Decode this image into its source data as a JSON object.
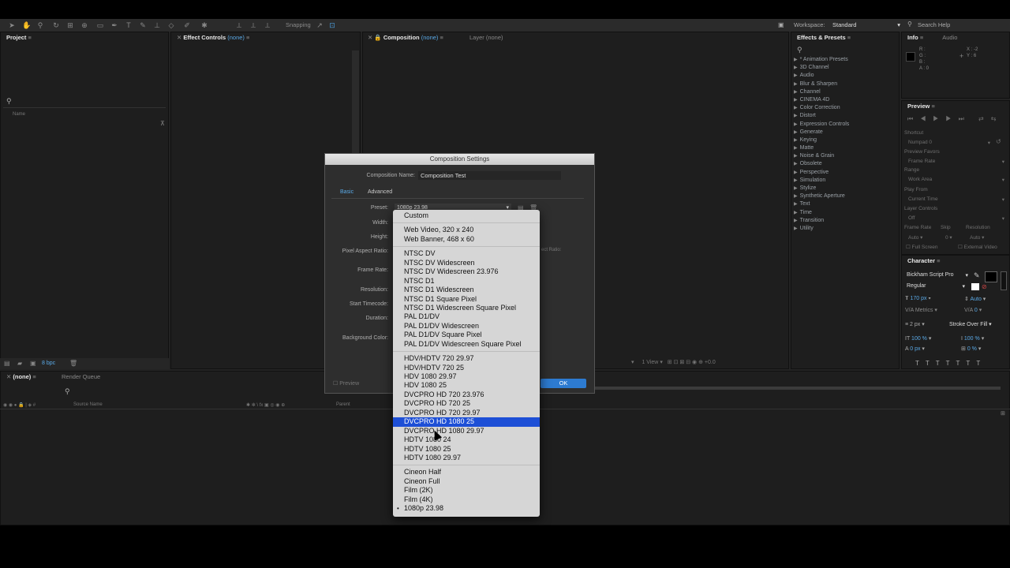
{
  "toolbar": {
    "snapping_label": "Snapping",
    "workspace_label": "Workspace:",
    "workspace_value": "Standard",
    "search_label": "Search Help"
  },
  "project_panel": {
    "title": "Project",
    "name_col": "Name",
    "bpc": "8 bpc"
  },
  "effect_controls": {
    "title": "Effect Controls",
    "target": "(none)"
  },
  "composition": {
    "title": "Composition",
    "target": "(none)",
    "layer_tab": "Layer (none)",
    "view_label": "1 View",
    "exposure": "+0.0"
  },
  "effects_presets": {
    "title": "Effects & Presets",
    "items": [
      "* Animation Presets",
      "3D Channel",
      "Audio",
      "Blur & Sharpen",
      "Channel",
      "CINEMA 4D",
      "Color Correction",
      "Distort",
      "Expression Controls",
      "Generate",
      "Keying",
      "Matte",
      "Noise & Grain",
      "Obsolete",
      "Perspective",
      "Simulation",
      "Stylize",
      "Synthetic Aperture",
      "Text",
      "Time",
      "Transition",
      "Utility"
    ]
  },
  "info": {
    "tab_info": "Info",
    "tab_audio": "Audio",
    "r": "R :",
    "g": "G :",
    "b": "B :",
    "a": "A : 0",
    "x": "X : -2",
    "y": "Y : 6"
  },
  "preview": {
    "title": "Preview",
    "shortcut_label": "Shortcut",
    "shortcut_value": "Numpad 0",
    "favors_label": "Preview Favors",
    "favors_value": "Frame Rate",
    "range_label": "Range",
    "range_value": "Work Area",
    "play_from_label": "Play From",
    "play_from_value": "Current Time",
    "layer_controls_label": "Layer Controls",
    "layer_controls_value": "Off",
    "frame_rate_label": "Frame Rate",
    "skip_label": "Skip",
    "resolution_label": "Resolution",
    "frame_rate_value": "Auto",
    "skip_value": "0",
    "resolution_value": "Auto",
    "full_screen": "Full Screen",
    "external_video": "External Video"
  },
  "character": {
    "title": "Character",
    "font": "Bickham Script Pro",
    "style": "Regular",
    "size": "170 px",
    "leading": "Auto",
    "kerning": "Metrics",
    "tracking": "0",
    "stroke_width": "2 px",
    "stroke_type": "Stroke Over Fill",
    "vscale": "100 %",
    "hscale": "100 %",
    "baseline": "0 px",
    "tsume": "0 %"
  },
  "timeline": {
    "tab": "(none)",
    "render_queue": "Render Queue",
    "source_name": "Source Name",
    "parent": "Parent"
  },
  "dialog": {
    "title": "Composition Settings",
    "comp_name_label": "Composition Name:",
    "comp_name_value": "Composition Test",
    "tab_basic": "Basic",
    "tab_advanced": "Advanced",
    "preset_label": "Preset:",
    "preset_value": "1080p 23.98",
    "width_label": "Width:",
    "height_label": "Height:",
    "par_label": "Pixel Aspect Ratio:",
    "frame_rate_label": "Frame Rate:",
    "resolution_label": "Resolution:",
    "start_tc_label": "Start Timecode:",
    "duration_label": "Duration:",
    "bg_color_label": "Background Color:",
    "aspect_ratio_frag": "ect Ratio:",
    "preview_label": "Preview",
    "ok_label": "OK"
  },
  "preset_menu": {
    "groups": [
      [
        "Custom"
      ],
      [
        "Web Video, 320 x 240",
        "Web Banner, 468 x 60"
      ],
      [
        "NTSC DV",
        "NTSC DV Widescreen",
        "NTSC DV Widescreen 23.976",
        "NTSC D1",
        "NTSC D1 Widescreen",
        "NTSC D1 Square Pixel",
        "NTSC D1 Widescreen Square Pixel",
        "PAL D1/DV",
        "PAL D1/DV Widescreen",
        "PAL D1/DV Square Pixel",
        "PAL D1/DV Widescreen Square Pixel"
      ],
      [
        "HDV/HDTV 720 29.97",
        "HDV/HDTV 720 25",
        "HDV 1080 29.97",
        "HDV 1080 25",
        "DVCPRO HD 720 23.976",
        "DVCPRO HD 720 25",
        "DVCPRO HD 720 29.97",
        "DVCPRO HD 1080 25",
        "DVCPRO HD 1080 29.97",
        "HDTV 1080 24",
        "HDTV 1080 25",
        "HDTV 1080 29.97"
      ],
      [
        "Cineon Half",
        "Cineon Full",
        "Film (2K)",
        "Film (4K)",
        "1080p 23.98"
      ]
    ],
    "highlighted": "DVCPRO HD 1080 25",
    "checked": "1080p 23.98"
  }
}
